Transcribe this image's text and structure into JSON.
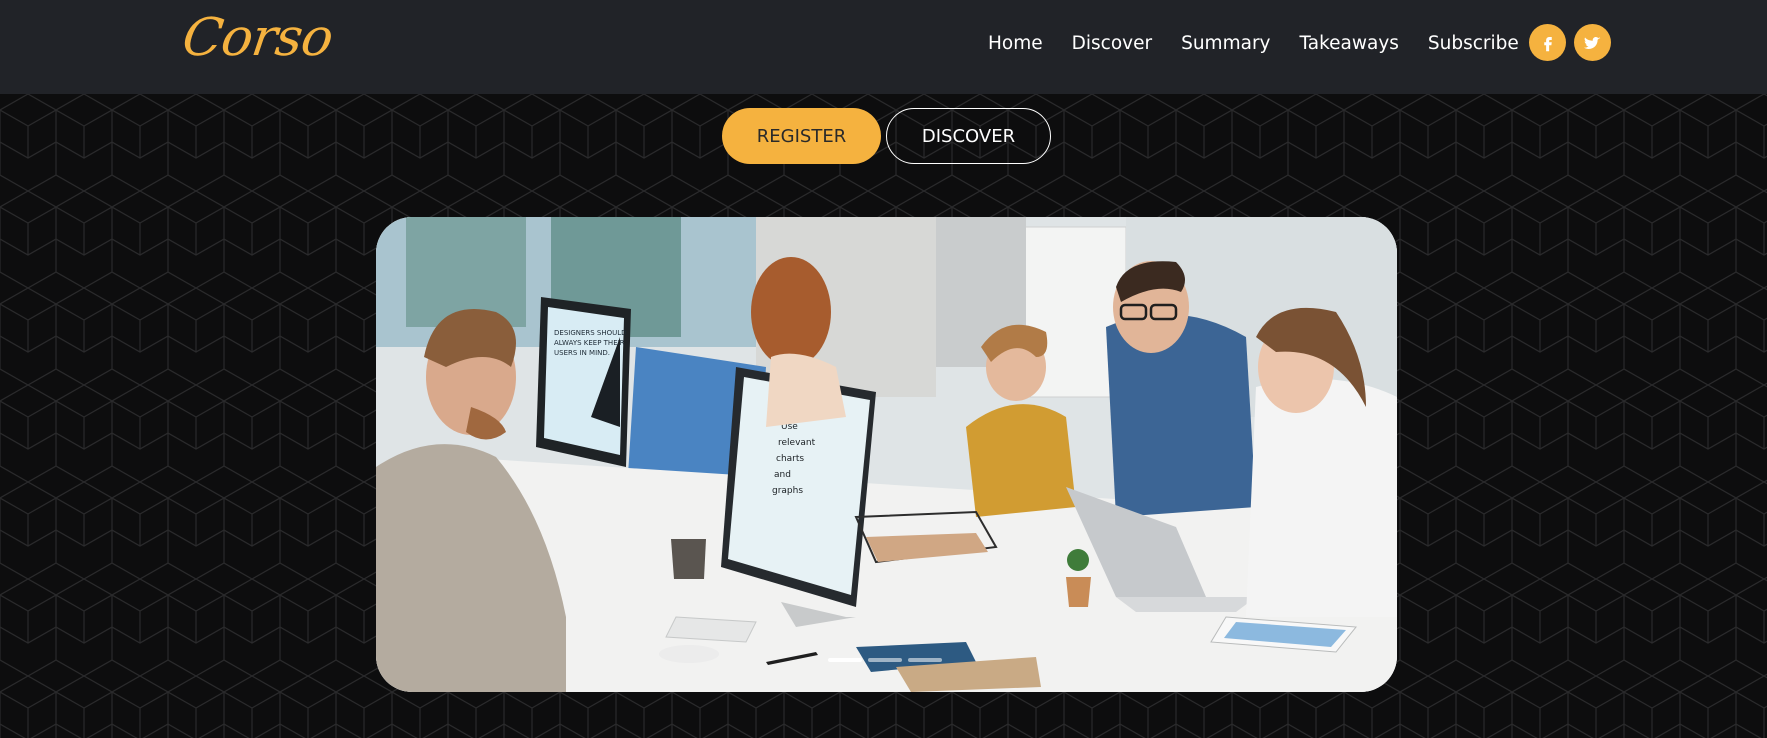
{
  "header": {
    "logo_text": "Corso",
    "nav": [
      "Home",
      "Discover",
      "Summary",
      "Takeaways",
      "Subscribe"
    ],
    "social": [
      {
        "icon": "facebook-icon"
      },
      {
        "icon": "twitter-icon"
      }
    ]
  },
  "cta": {
    "register_label": "REGISTER",
    "discover_label": "DISCOVER"
  },
  "hero": {
    "screen_text_1": "DESIGNERS SHOULD ALWAYS KEEP THEIR USERS IN MIND.",
    "screen_text_2": [
      "Use",
      "relevant",
      "charts",
      "and",
      "graphs"
    ],
    "slide_count": 3,
    "active_slide": 0
  },
  "colors": {
    "accent": "#f5b23f",
    "header_bg": "#212328",
    "page_bg": "#0d0d0e"
  }
}
